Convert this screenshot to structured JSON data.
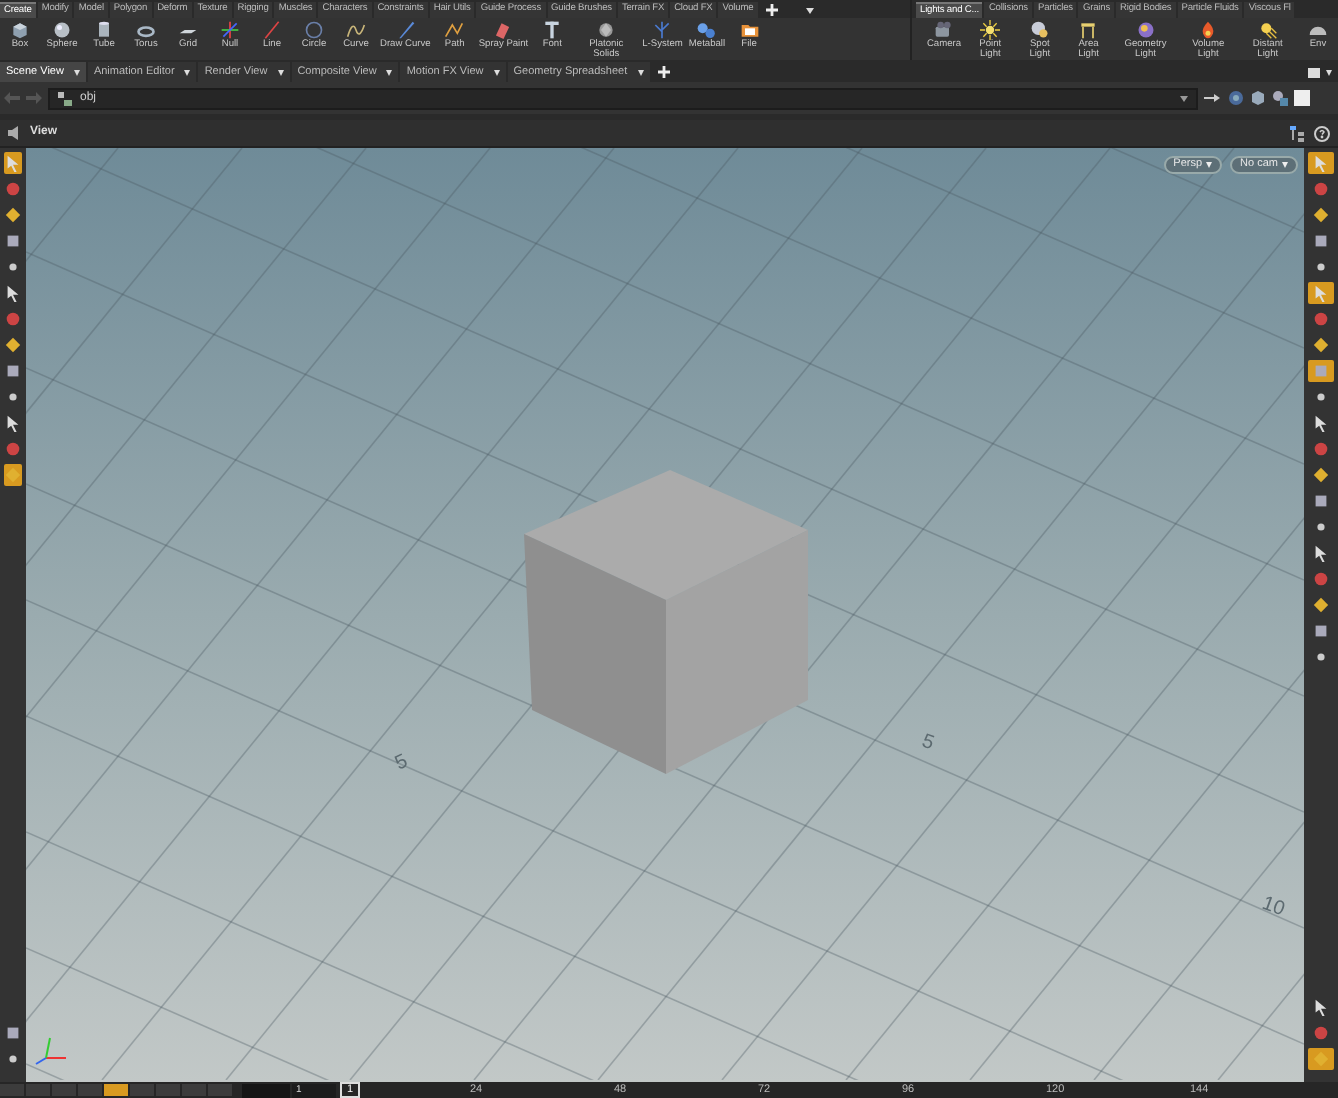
{
  "shelf_left": {
    "tabs": [
      {
        "label": "Create",
        "selected": true
      },
      {
        "label": "Modify",
        "selected": false
      },
      {
        "label": "Model",
        "selected": false
      },
      {
        "label": "Polygon",
        "selected": false
      },
      {
        "label": "Deform",
        "selected": false
      },
      {
        "label": "Texture",
        "selected": false
      },
      {
        "label": "Rigging",
        "selected": false
      },
      {
        "label": "Muscles",
        "selected": false
      },
      {
        "label": "Characters",
        "selected": false
      },
      {
        "label": "Constraints",
        "selected": false
      },
      {
        "label": "Hair Utils",
        "selected": false
      },
      {
        "label": "Guide Process",
        "selected": false
      },
      {
        "label": "Guide Brushes",
        "selected": false
      },
      {
        "label": "Terrain FX",
        "selected": false
      },
      {
        "label": "Cloud FX",
        "selected": false
      },
      {
        "label": "Volume",
        "selected": false
      }
    ],
    "tools": [
      "Box",
      "Sphere",
      "Tube",
      "Torus",
      "Grid",
      "Null",
      "Line",
      "Circle",
      "Curve",
      "Draw Curve",
      "Path",
      "Spray Paint",
      "Font",
      "Platonic Solids",
      "L-System",
      "Metaball",
      "File"
    ]
  },
  "shelf_right": {
    "tabs": [
      {
        "label": "Lights and C...",
        "selected": true
      },
      {
        "label": "Collisions",
        "selected": false
      },
      {
        "label": "Particles",
        "selected": false
      },
      {
        "label": "Grains",
        "selected": false
      },
      {
        "label": "Rigid Bodies",
        "selected": false
      },
      {
        "label": "Particle Fluids",
        "selected": false
      },
      {
        "label": "Viscous Fl",
        "selected": false
      }
    ],
    "tools": [
      "Camera",
      "Point Light",
      "Spot Light",
      "Area Light",
      "Geometry Light",
      "Volume Light",
      "Distant Light",
      "Env"
    ]
  },
  "pane_tabs": [
    {
      "label": "Scene View",
      "selected": true
    },
    {
      "label": "Animation Editor",
      "selected": false
    },
    {
      "label": "Render View",
      "selected": false
    },
    {
      "label": "Composite View",
      "selected": false
    },
    {
      "label": "Motion FX View",
      "selected": false
    },
    {
      "label": "Geometry Spreadsheet",
      "selected": false
    }
  ],
  "path_bar": {
    "path": "obj"
  },
  "viewport": {
    "title": "View",
    "camera_menus": [
      "Persp",
      "No cam"
    ],
    "grid_labels": [
      "5",
      "5",
      "10"
    ]
  },
  "left_toolbar": [
    {
      "selected": true
    },
    {
      "selected": false
    },
    {
      "selected": false
    },
    {
      "selected": false
    },
    {
      "selected": false
    },
    {
      "selected": false
    },
    {
      "selected": false
    },
    {
      "selected": false
    },
    {
      "selected": false
    },
    {
      "selected": false
    },
    {
      "selected": false
    },
    {
      "selected": false
    },
    {
      "selected": true
    },
    {
      "selected": false
    },
    {
      "selected": false
    }
  ],
  "right_toolbar": [
    {
      "selected": true
    },
    {
      "selected": false
    },
    {
      "selected": false
    },
    {
      "selected": false
    },
    {
      "selected": false
    },
    {
      "selected": true
    },
    {
      "selected": false
    },
    {
      "selected": false
    },
    {
      "selected": true
    },
    {
      "selected": false
    },
    {
      "selected": false
    },
    {
      "selected": false
    },
    {
      "selected": false
    },
    {
      "selected": false
    },
    {
      "selected": false
    },
    {
      "selected": false
    },
    {
      "selected": false
    },
    {
      "selected": false
    },
    {
      "selected": false
    },
    {
      "selected": false
    },
    {
      "selected": false
    },
    {
      "selected": false
    },
    {
      "selected": true
    }
  ],
  "timeline": {
    "playback_buttons": [
      {
        "selected": false
      },
      {
        "selected": false
      },
      {
        "selected": false
      },
      {
        "selected": false
      },
      {
        "selected": true
      },
      {
        "selected": false
      },
      {
        "selected": false
      },
      {
        "selected": false
      },
      {
        "selected": false
      }
    ],
    "start_frame": "1",
    "current_frame": "1",
    "ticks": [
      "24",
      "48",
      "72",
      "96",
      "120",
      "144"
    ]
  }
}
